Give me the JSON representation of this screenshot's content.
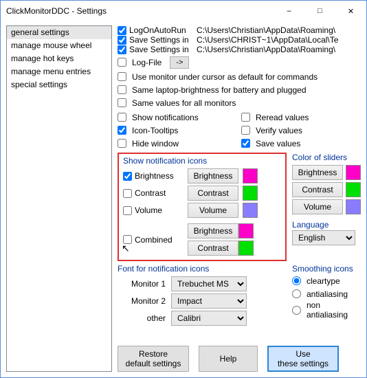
{
  "window": {
    "title": "ClickMonitorDDC - Settings"
  },
  "sidebar": {
    "items": [
      "general settings",
      "manage mouse wheel",
      "manage hot keys",
      "manage menu entries",
      "special settings"
    ],
    "selected": 0
  },
  "top": [
    {
      "checked": true,
      "label": "LogOnAutoRun",
      "path": "C:\\Users\\Christian\\AppData\\Roaming\\"
    },
    {
      "checked": true,
      "label": "Save Settings in",
      "path": "C:\\Users\\CHRIST~1\\AppData\\Local\\Te"
    },
    {
      "checked": true,
      "label": "Save Settings in",
      "path": "C:\\Users\\Christian\\AppData\\Roaming\\"
    }
  ],
  "logfile": {
    "checked": false,
    "label": "Log-File",
    "arrow": "->"
  },
  "singles": [
    {
      "checked": false,
      "label": "Use monitor under cursor as default for commands"
    },
    {
      "checked": false,
      "label": "Same laptop-brightness for battery and plugged"
    },
    {
      "checked": false,
      "label": "Same values for all monitors"
    }
  ],
  "leftOpts": [
    {
      "checked": false,
      "label": "Show notifications"
    },
    {
      "checked": true,
      "label": "Icon-Tooltips"
    },
    {
      "checked": false,
      "label": "Hide window"
    }
  ],
  "rightOpts": [
    {
      "checked": false,
      "label": "Reread values"
    },
    {
      "checked": false,
      "label": "Verify values"
    },
    {
      "checked": true,
      "label": "Save values"
    }
  ],
  "notifGroup": {
    "title": "Show notification icons",
    "rows": [
      {
        "checked": true,
        "chk": "Brightness",
        "btn": "Brightness",
        "swatch": "magenta"
      },
      {
        "checked": false,
        "chk": "Contrast",
        "btn": "Contrast",
        "swatch": "green"
      },
      {
        "checked": false,
        "chk": "Volume",
        "btn": "Volume",
        "swatch": "purple"
      }
    ],
    "combined": {
      "checked": false,
      "chk": "Combined",
      "btns": [
        "Brightness",
        "Contrast"
      ],
      "swatches": [
        "magenta",
        "green"
      ]
    }
  },
  "sliderGroup": {
    "title": "Color of sliders",
    "rows": [
      {
        "btn": "Brightness",
        "swatch": "magenta"
      },
      {
        "btn": "Contrast",
        "swatch": "green"
      },
      {
        "btn": "Volume",
        "swatch": "purple"
      }
    ]
  },
  "language": {
    "title": "Language",
    "value": "English"
  },
  "fontGroup": {
    "title": "Font for notification icons",
    "rows": [
      {
        "label": "Monitor 1",
        "value": "Trebuchet MS"
      },
      {
        "label": "Monitor 2",
        "value": "Impact"
      },
      {
        "label": "other",
        "value": "Calibri"
      }
    ]
  },
  "smoothing": {
    "title": "Smoothing icons",
    "options": [
      {
        "label": "cleartype",
        "checked": true
      },
      {
        "label": "antialiasing",
        "checked": false
      },
      {
        "label": "non antialiasing",
        "checked": false
      }
    ]
  },
  "footer": {
    "restore": "Restore\ndefault settings",
    "help": "Help",
    "use": "Use\nthese settings"
  }
}
